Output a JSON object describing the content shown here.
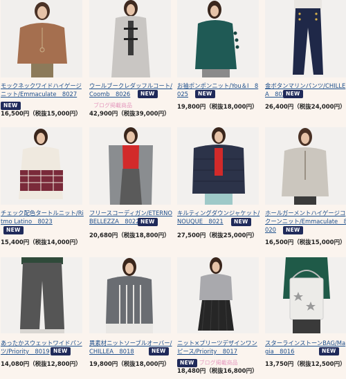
{
  "products": [
    {
      "title": "モックネックワイドハイゲージニット/Emmaculate　8027",
      "new": "NEW",
      "blog": "",
      "price": "16,500円（税抜15,000円）"
    },
    {
      "title": "ウールブークレダッフルコート/Coomb　8026",
      "new": "NEW",
      "blog": "ブログ掲載商品",
      "price": "42,900円（税抜39,000円）"
    },
    {
      "title": "お袖ポンポンニット/You＆I　8025",
      "new": "NEW",
      "blog": "",
      "price": "19,800円（税抜18,000円）"
    },
    {
      "title": "金ボタンマリンパンツ/CHILLEA　8024",
      "new": "NEW",
      "blog": "",
      "price": "26,400円（税抜24,000円）"
    },
    {
      "title": "チェック配色タートルニット/Ritmo Latino　8023",
      "new": "NEW",
      "blog": "",
      "price": "15,400円（税抜14,000円）"
    },
    {
      "title": "フリースコーディガン/ETERNO BELLEZZA　8022",
      "new": "NEW",
      "blog": "",
      "price": "20,680円（税抜18,800円）"
    },
    {
      "title": "キルティングダウンジャケット/NOUQUE　8021",
      "new": "NEW",
      "blog": "",
      "price": "27,500円（税抜25,000円）"
    },
    {
      "title": "ホールガーメントハイゲージコクーンニット/Emmaculate　8020",
      "new": "NEW",
      "blog": "",
      "price": "16,500円（税抜15,000円）"
    },
    {
      "title": "あったかスウェットワイドパンツ/Priority　8019",
      "new": "NEW",
      "blog": "",
      "price": "14,080円（税抜12,800円）"
    },
    {
      "title": "異素材ニットソーブルオーバー/CHILLEA　8018",
      "new": "NEW",
      "blog": "",
      "price": "19,800円（税抜18,000円）"
    },
    {
      "title": "ニット×プリーツデザインワンピース/Priority　8017",
      "new": "NEW",
      "blog": "ブログ掲載商品",
      "price": "18,480円（税抜16,800円）"
    },
    {
      "title": "スターラインストーンBAG/Magia　8016",
      "new": "NEW",
      "blog": "",
      "price": "13,750円（税抜12,500円）"
    }
  ],
  "colors": {
    "link": "#1d4f8c",
    "badge": "#1f2a5a",
    "blog": "#e59bbf",
    "background": "#fbf4ee"
  }
}
